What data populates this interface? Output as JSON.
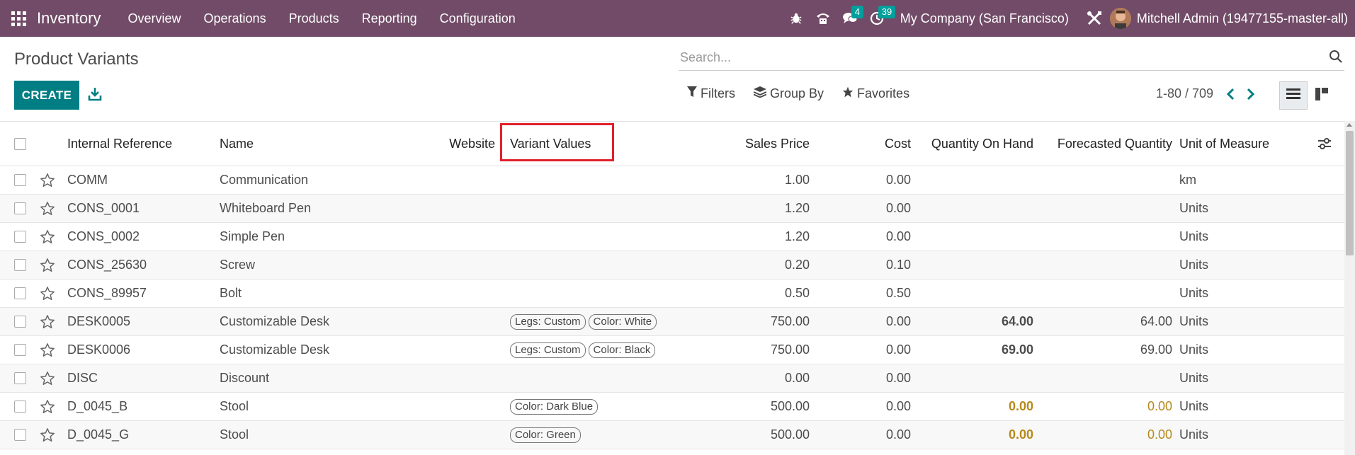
{
  "navbar": {
    "brand": "Inventory",
    "menu": [
      "Overview",
      "Operations",
      "Products",
      "Reporting",
      "Configuration"
    ],
    "messages_count": "4",
    "activities_count": "39",
    "company": "My Company (San Francisco)",
    "user": "Mitchell Admin (19477155-master-all)"
  },
  "control": {
    "title": "Product Variants",
    "search_placeholder": "Search...",
    "create_label": "CREATE",
    "filters_label": "Filters",
    "groupby_label": "Group By",
    "favorites_label": "Favorites",
    "pager": "1-80 / 709"
  },
  "table": {
    "headers": {
      "internal_reference": "Internal Reference",
      "name": "Name",
      "website": "Website",
      "variant_values": "Variant Values",
      "sales_price": "Sales Price",
      "cost": "Cost",
      "qty_on_hand": "Quantity On Hand",
      "forecasted": "Forecasted Quantity",
      "uom": "Unit of Measure"
    },
    "rows": [
      {
        "ref": "COMM",
        "name": "Communication",
        "tags": [],
        "price": "1.00",
        "cost": "0.00",
        "onhand": "",
        "forecast": "",
        "uom": "km"
      },
      {
        "ref": "CONS_0001",
        "name": "Whiteboard Pen",
        "tags": [],
        "price": "1.20",
        "cost": "0.00",
        "onhand": "",
        "forecast": "",
        "uom": "Units"
      },
      {
        "ref": "CONS_0002",
        "name": "Simple Pen",
        "tags": [],
        "price": "1.20",
        "cost": "0.00",
        "onhand": "",
        "forecast": "",
        "uom": "Units"
      },
      {
        "ref": "CONS_25630",
        "name": "Screw",
        "tags": [],
        "price": "0.20",
        "cost": "0.10",
        "onhand": "",
        "forecast": "",
        "uom": "Units"
      },
      {
        "ref": "CONS_89957",
        "name": "Bolt",
        "tags": [],
        "price": "0.50",
        "cost": "0.50",
        "onhand": "",
        "forecast": "",
        "uom": "Units"
      },
      {
        "ref": "DESK0005",
        "name": "Customizable Desk",
        "tags": [
          "Legs: Custom",
          "Color: White"
        ],
        "price": "750.00",
        "cost": "0.00",
        "onhand": "64.00",
        "forecast": "64.00",
        "uom": "Units"
      },
      {
        "ref": "DESK0006",
        "name": "Customizable Desk",
        "tags": [
          "Legs: Custom",
          "Color: Black"
        ],
        "price": "750.00",
        "cost": "0.00",
        "onhand": "69.00",
        "forecast": "69.00",
        "uom": "Units"
      },
      {
        "ref": "DISC",
        "name": "Discount",
        "tags": [],
        "price": "0.00",
        "cost": "0.00",
        "onhand": "",
        "forecast": "",
        "uom": "Units"
      },
      {
        "ref": "D_0045_B",
        "name": "Stool",
        "tags": [
          "Color: Dark Blue"
        ],
        "price": "500.00",
        "cost": "0.00",
        "onhand": "0.00",
        "forecast": "0.00",
        "uom": "Units",
        "warn": true
      },
      {
        "ref": "D_0045_G",
        "name": "Stool",
        "tags": [
          "Color: Green"
        ],
        "price": "500.00",
        "cost": "0.00",
        "onhand": "0.00",
        "forecast": "0.00",
        "uom": "Units",
        "warn": true
      }
    ]
  },
  "colors": {
    "navbar": "#714b67",
    "primary": "#017e84",
    "badge": "#00a09d",
    "highlight": "#e0202b",
    "warning": "#b6891b"
  }
}
